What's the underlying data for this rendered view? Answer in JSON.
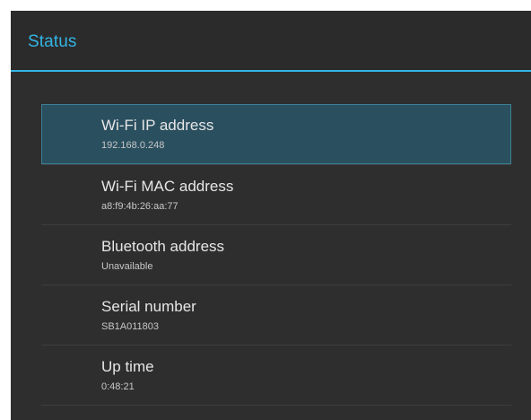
{
  "header": {
    "title": "Status",
    "accent_color": "#33b5e5"
  },
  "items": [
    {
      "title": "Wi-Fi IP address",
      "value": "192.168.0.248",
      "selected": true
    },
    {
      "title": "Wi-Fi MAC address",
      "value": "a8:f9:4b:26:aa:77",
      "selected": false
    },
    {
      "title": "Bluetooth address",
      "value": "Unavailable",
      "selected": false
    },
    {
      "title": "Serial number",
      "value": "SB1A011803",
      "selected": false
    },
    {
      "title": "Up time",
      "value": "0:48:21",
      "selected": false
    }
  ]
}
